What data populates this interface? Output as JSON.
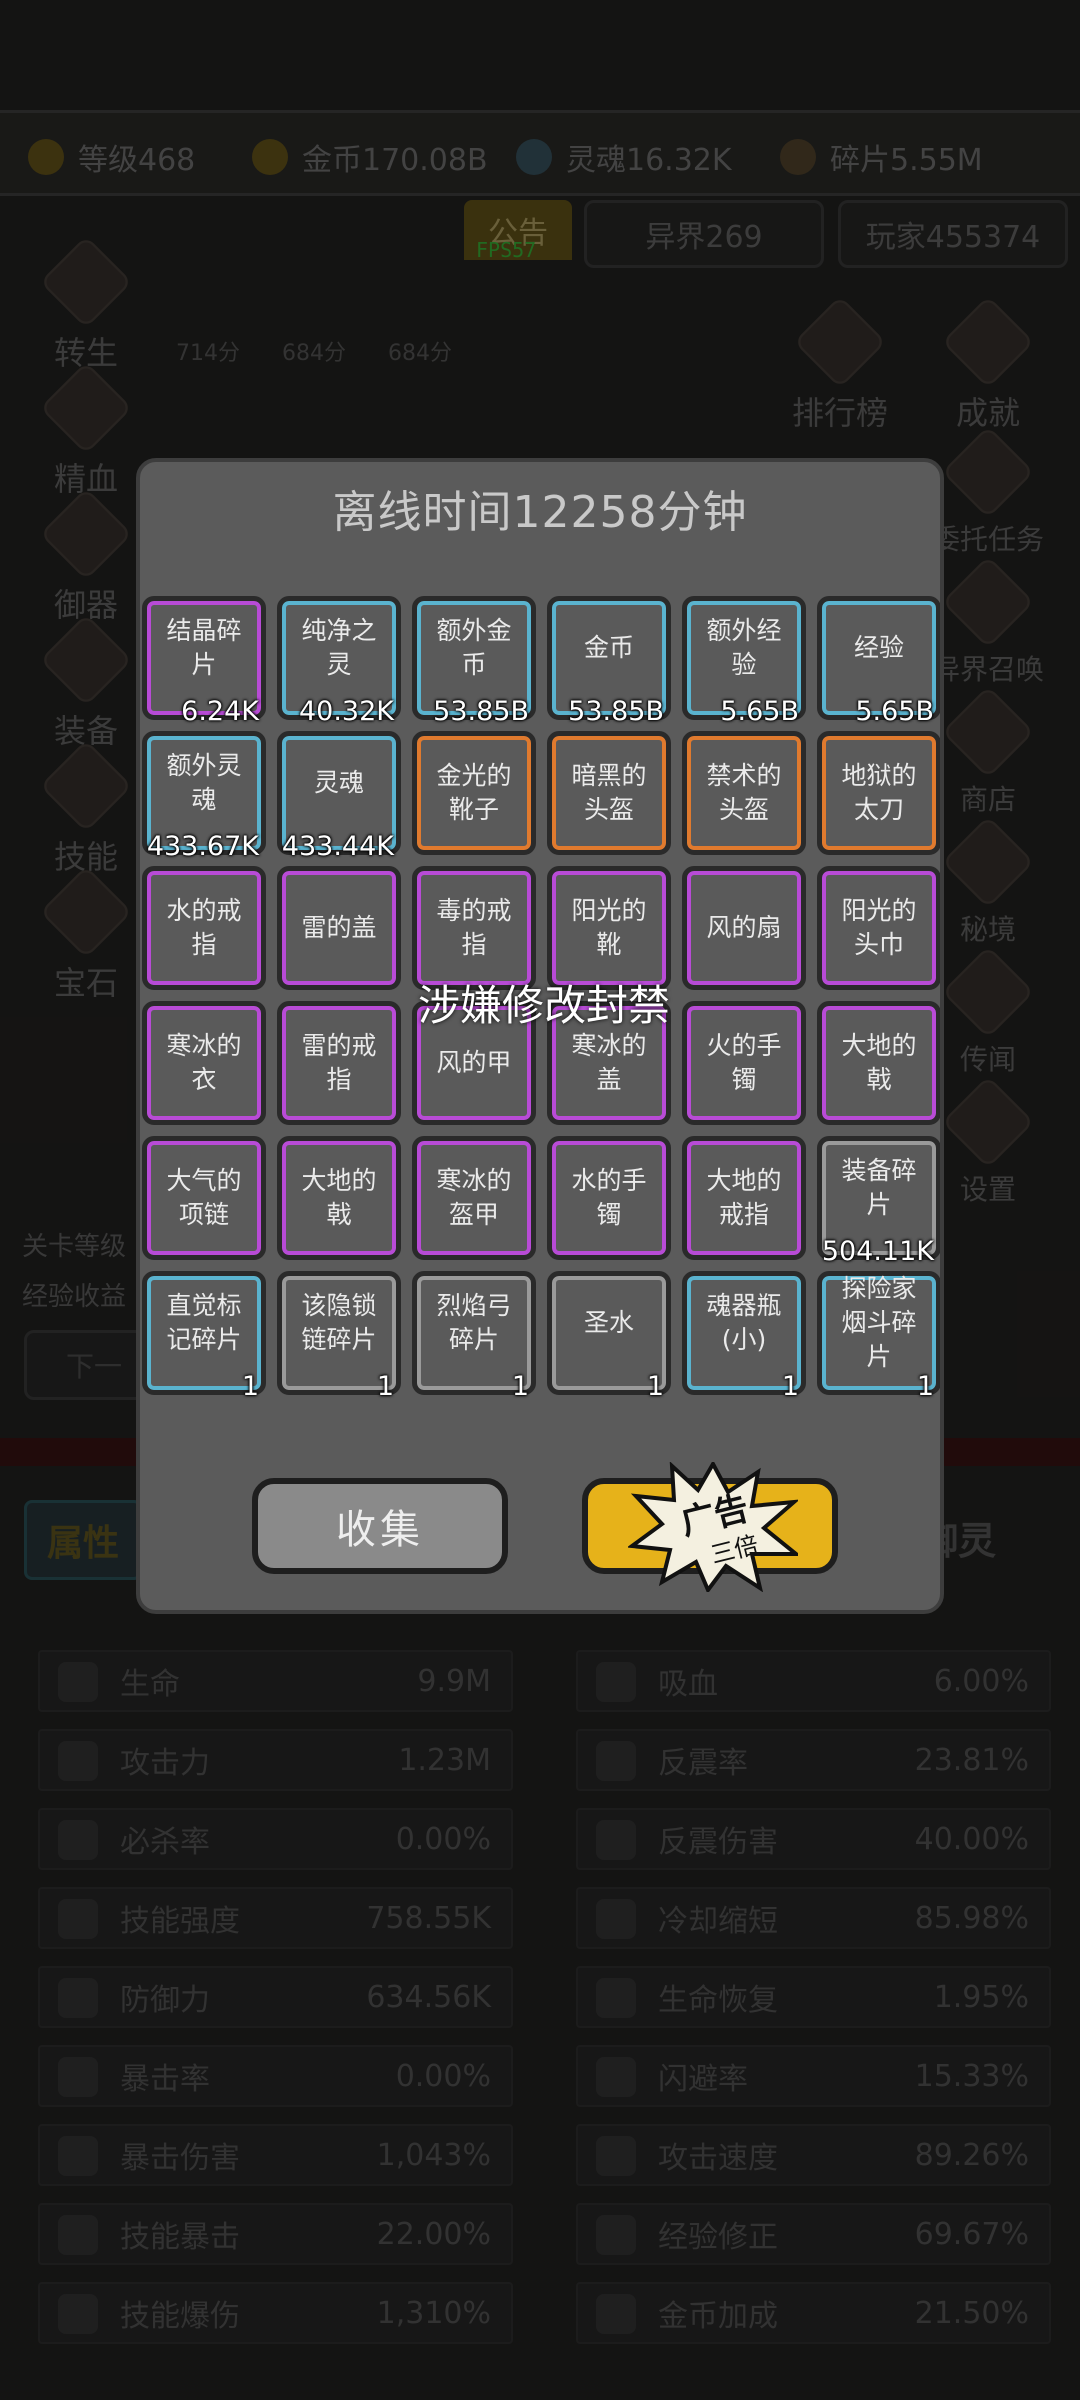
{
  "background": {
    "resources": [
      {
        "label": "等级468",
        "icon": "crown-icon"
      },
      {
        "label": "金币170.08B",
        "icon": "coin-icon"
      },
      {
        "label": "灵魂16.32K",
        "icon": "soul-icon"
      },
      {
        "label": "碎片5.55M",
        "icon": "shard-icon"
      }
    ],
    "notice_tab": "公告",
    "fps": "FPS57",
    "realm_label": "异界269",
    "player_label": "玩家455374",
    "left_menu": [
      "转生",
      "精血",
      "御器",
      "装备",
      "技能",
      "宝石"
    ],
    "right_menu": [
      "排行榜",
      "成就",
      "委托任务",
      "异界召唤",
      "商店",
      "秘境",
      "传闻",
      "设置"
    ],
    "small_values": [
      "714分",
      "684分",
      "684分"
    ],
    "level_info": [
      "关卡等级",
      "经验收益"
    ],
    "next_button": "下一",
    "attr_tab": "属性",
    "right_tab": "御灵",
    "stats_left": [
      {
        "label": "生命",
        "value": "9.9M"
      },
      {
        "label": "攻击力",
        "value": "1.23M"
      },
      {
        "label": "必杀率",
        "value": "0.00%"
      },
      {
        "label": "技能强度",
        "value": "758.55K"
      },
      {
        "label": "防御力",
        "value": "634.56K"
      },
      {
        "label": "暴击率",
        "value": "0.00%"
      },
      {
        "label": "暴击伤害",
        "value": "1,043%"
      },
      {
        "label": "技能暴击",
        "value": "22.00%"
      },
      {
        "label": "技能爆伤",
        "value": "1,310%"
      }
    ],
    "stats_right": [
      {
        "label": "吸血",
        "value": "6.00%"
      },
      {
        "label": "反震率",
        "value": "23.81%"
      },
      {
        "label": "反震伤害",
        "value": "40.00%"
      },
      {
        "label": "冷却缩短",
        "value": "85.98%"
      },
      {
        "label": "生命恢复",
        "value": "1.95%"
      },
      {
        "label": "闪避率",
        "value": "15.33%"
      },
      {
        "label": "攻击速度",
        "value": "89.26%"
      },
      {
        "label": "经验修正",
        "value": "69.67%"
      },
      {
        "label": "金币加成",
        "value": "21.50%"
      }
    ]
  },
  "dialog": {
    "title": "离线时间12258分钟",
    "ban_text": "涉嫌修改封禁",
    "collect_label": "收集",
    "ad_label": "广告",
    "ad_sub": "三倍",
    "quality_colors": {
      "purple": "#b84bd6",
      "blue": "#5ab3cf",
      "orange": "#e07a2e",
      "gray": "#9a9a9a"
    },
    "items": [
      {
        "name": "结晶碎片",
        "count": "6.24K",
        "quality": "purple"
      },
      {
        "name": "纯净之灵",
        "count": "40.32K",
        "quality": "blue"
      },
      {
        "name": "额外金币",
        "count": "53.85B",
        "quality": "blue"
      },
      {
        "name": "金币",
        "count": "53.85B",
        "quality": "blue"
      },
      {
        "name": "额外经验",
        "count": "5.65B",
        "quality": "blue"
      },
      {
        "name": "经验",
        "count": "5.65B",
        "quality": "blue"
      },
      {
        "name": "额外灵魂",
        "count": "433.67K",
        "quality": "blue"
      },
      {
        "name": "灵魂",
        "count": "433.44K",
        "quality": "blue"
      },
      {
        "name": "金光的靴子",
        "count": "",
        "quality": "orange"
      },
      {
        "name": "暗黑的头盔",
        "count": "",
        "quality": "orange"
      },
      {
        "name": "禁术的头盔",
        "count": "",
        "quality": "orange"
      },
      {
        "name": "地狱的太刀",
        "count": "",
        "quality": "orange"
      },
      {
        "name": "水的戒指",
        "count": "",
        "quality": "purple"
      },
      {
        "name": "雷的盖",
        "count": "",
        "quality": "purple"
      },
      {
        "name": "毒的戒指",
        "count": "",
        "quality": "purple"
      },
      {
        "name": "阳光的靴",
        "count": "",
        "quality": "purple"
      },
      {
        "name": "风的扇",
        "count": "",
        "quality": "purple"
      },
      {
        "name": "阳光的头巾",
        "count": "",
        "quality": "purple"
      },
      {
        "name": "寒冰的衣",
        "count": "",
        "quality": "purple"
      },
      {
        "name": "雷的戒指",
        "count": "",
        "quality": "purple"
      },
      {
        "name": "风的甲",
        "count": "",
        "quality": "purple"
      },
      {
        "name": "寒冰的盖",
        "count": "",
        "quality": "purple"
      },
      {
        "name": "火的手镯",
        "count": "",
        "quality": "purple"
      },
      {
        "name": "大地的戟",
        "count": "",
        "quality": "purple"
      },
      {
        "name": "大气的项链",
        "count": "",
        "quality": "purple"
      },
      {
        "name": "大地的戟",
        "count": "",
        "quality": "purple"
      },
      {
        "name": "寒冰的盔甲",
        "count": "",
        "quality": "purple"
      },
      {
        "name": "水的手镯",
        "count": "",
        "quality": "purple"
      },
      {
        "name": "大地的戒指",
        "count": "",
        "quality": "purple"
      },
      {
        "name": "装备碎片",
        "count": "504.11K",
        "quality": "gray"
      },
      {
        "name": "直觉标记碎片",
        "count": "1",
        "quality": "blue"
      },
      {
        "name": "该隐锁链碎片",
        "count": "1",
        "quality": "gray"
      },
      {
        "name": "烈焰弓碎片",
        "count": "1",
        "quality": "gray"
      },
      {
        "name": "圣水",
        "count": "1",
        "quality": "gray"
      },
      {
        "name": "魂器瓶(小)",
        "count": "1",
        "quality": "blue"
      },
      {
        "name": "探险家烟斗碎片",
        "count": "1",
        "quality": "blue"
      }
    ]
  }
}
